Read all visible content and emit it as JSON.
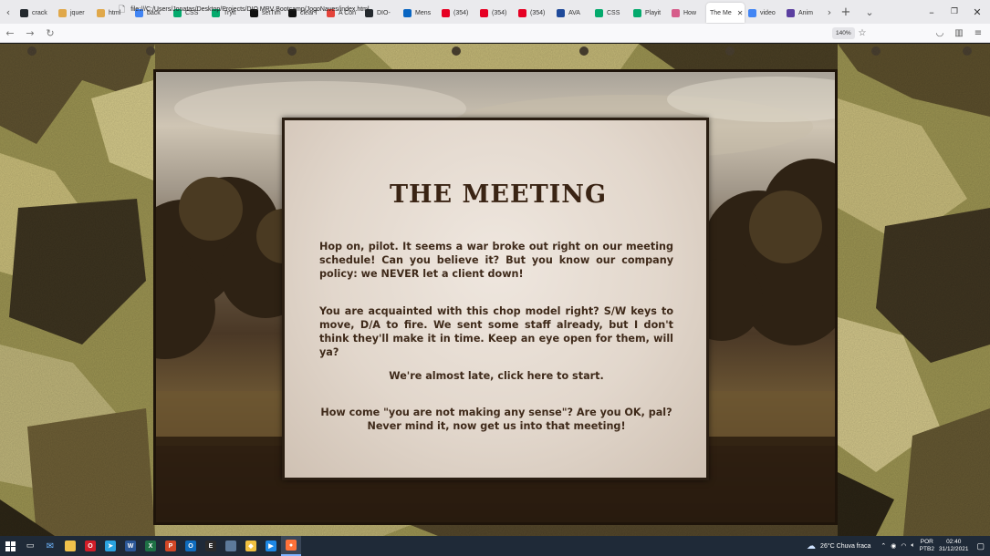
{
  "browser": {
    "tabs": [
      {
        "label": "crack",
        "icon": "github-icon",
        "color": "#24292e"
      },
      {
        "label": "jquer",
        "icon": "pencil-icon",
        "color": "#e0a84a"
      },
      {
        "label": "html",
        "icon": "pencil-icon",
        "color": "#e0a84a"
      },
      {
        "label": "back",
        "icon": "google-icon",
        "color": "#4285f4"
      },
      {
        "label": "CSS",
        "icon": "w3schools-icon",
        "color": "#04aa6d"
      },
      {
        "label": "Tryit",
        "icon": "w3schools-icon",
        "color": "#04aa6d"
      },
      {
        "label": "setTim",
        "icon": "mdn-icon",
        "color": "#111111"
      },
      {
        "label": "clearT",
        "icon": "mdn-icon",
        "color": "#111111"
      },
      {
        "label": "A Con",
        "icon": "star-icon",
        "color": "#e4433a"
      },
      {
        "label": "DIO-",
        "icon": "github-icon",
        "color": "#24292e"
      },
      {
        "label": "Mens",
        "icon": "linkedin-icon",
        "color": "#0a66c2"
      },
      {
        "label": "(354)",
        "icon": "pinterest-icon",
        "color": "#e60023"
      },
      {
        "label": "(354)",
        "icon": "pinterest-icon",
        "color": "#e60023"
      },
      {
        "label": "(354)",
        "icon": "pinterest-icon",
        "color": "#e60023"
      },
      {
        "label": "AVA",
        "icon": "ava-icon",
        "color": "#1f4a9a"
      },
      {
        "label": "CSS",
        "icon": "w3schools-icon",
        "color": "#04aa6d"
      },
      {
        "label": "Playit",
        "icon": "w3schools-icon",
        "color": "#04aa6d"
      },
      {
        "label": "How",
        "icon": "chrome-icon",
        "color": "#d65c8a"
      },
      {
        "label": "The Me",
        "icon": "",
        "color": "#ffffff",
        "active": true
      },
      {
        "label": "video",
        "icon": "google-icon",
        "color": "#4285f4"
      },
      {
        "label": "Anim",
        "icon": "doc-icon",
        "color": "#5b3fa0"
      }
    ],
    "url": "file:///C:/Users/Jonatas/Desktop/Projects/DIO MRV Bootcamp/JogoNaves/index.html",
    "zoom": "140%"
  },
  "page": {
    "title": "THE MEETING",
    "paragraphs": [
      "Hop on, pilot. It seems a war broke out right on our meeting schedule! Can you believe it? But you know our company policy: we NEVER let a client down!",
      "You are acquainted with this chop model right? S/W keys to move, D/A to fire. We sent some staff already, but I don't think they'll make it in time. Keep an eye open for them, will ya?"
    ],
    "start_text": "We're almost late, click here to start.",
    "closing_line1": "How come \"you are not making any sense\"? Are you OK, pal?",
    "closing_line2": "Never mind it, now get us into that meeting!"
  },
  "taskbar": {
    "apps": [
      {
        "name": "file-explorer-icon",
        "color": "#f0c14b",
        "glyph": ""
      },
      {
        "name": "opera-icon",
        "color": "#d11d28",
        "glyph": "O"
      },
      {
        "name": "telegram-icon",
        "color": "#2aa3e0",
        "glyph": "➤"
      },
      {
        "name": "word-icon",
        "color": "#2b5797",
        "glyph": "W"
      },
      {
        "name": "excel-icon",
        "color": "#1e7145",
        "glyph": "X"
      },
      {
        "name": "powerpoint-icon",
        "color": "#d24726",
        "glyph": "P"
      },
      {
        "name": "outlook-icon",
        "color": "#0f6cbd",
        "glyph": "O"
      },
      {
        "name": "epic-games-icon",
        "color": "#2b2b2b",
        "glyph": "E"
      },
      {
        "name": "app-icon",
        "color": "#5d7a9a",
        "glyph": ""
      },
      {
        "name": "git-icon",
        "color": "#f0c040",
        "glyph": "◆"
      },
      {
        "name": "vscode-icon",
        "color": "#1e88e5",
        "glyph": "▶"
      },
      {
        "name": "firefox-icon",
        "color": "#ff7139",
        "glyph": "●"
      }
    ],
    "weather": "26°C Chuva fraca",
    "lang_top": "POR",
    "lang_bottom": "PTB2",
    "time": "02:40",
    "date": "31/12/2021"
  }
}
